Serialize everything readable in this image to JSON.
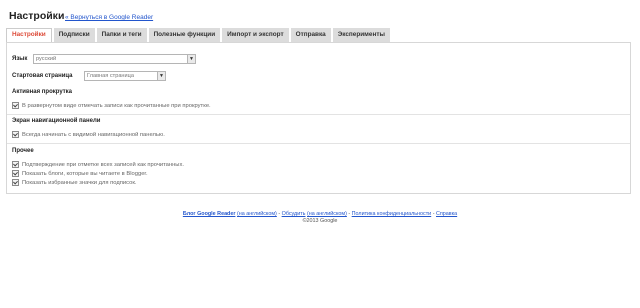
{
  "header": {
    "title": "Настройки",
    "back_link": "« Вернуться в Google Reader"
  },
  "tabs": [
    {
      "label": "Настройки",
      "active": true
    },
    {
      "label": "Подписки",
      "active": false
    },
    {
      "label": "Папки и теги",
      "active": false
    },
    {
      "label": "Полезные функции",
      "active": false
    },
    {
      "label": "Импорт и экспорт",
      "active": false
    },
    {
      "label": "Отправка",
      "active": false
    },
    {
      "label": "Эксперименты",
      "active": false
    }
  ],
  "settings": {
    "language_label": "Язык",
    "language_value": "русский",
    "start_page_label": "Стартовая страница",
    "start_page_value": "Главная страница",
    "auto_scroll": {
      "title": "Активная прокрутка",
      "option": "В развернутом виде отмечать записи как прочитанные при прокрутке."
    },
    "nav_panel": {
      "title": "Экран навигационной панели",
      "option": "Всегда начинать с видимой навигационной панелью."
    },
    "other": {
      "title": "Прочее",
      "options": [
        "Подтверждение при отметке всех записей как прочитанных.",
        "Показать блоги, которые вы читаете в Blogger.",
        "Показать избранные значки для подписок."
      ]
    }
  },
  "footer": {
    "blog_link": "Блог Google Reader",
    "blog_lang": "(на английском)",
    "sep1": " - ",
    "discuss_link": "Обсудить",
    "discuss_lang": "(на английском)",
    "sep2": " - ",
    "privacy_link": "Политика конфиденциальности",
    "sep3": " - ",
    "help_link": "Справка",
    "copyright": "©2013 Google"
  },
  "colors": {
    "active_tab_text": "#dd4b39",
    "inactive_tab_bg": "#dcdcdc",
    "link": "#2255cc"
  }
}
